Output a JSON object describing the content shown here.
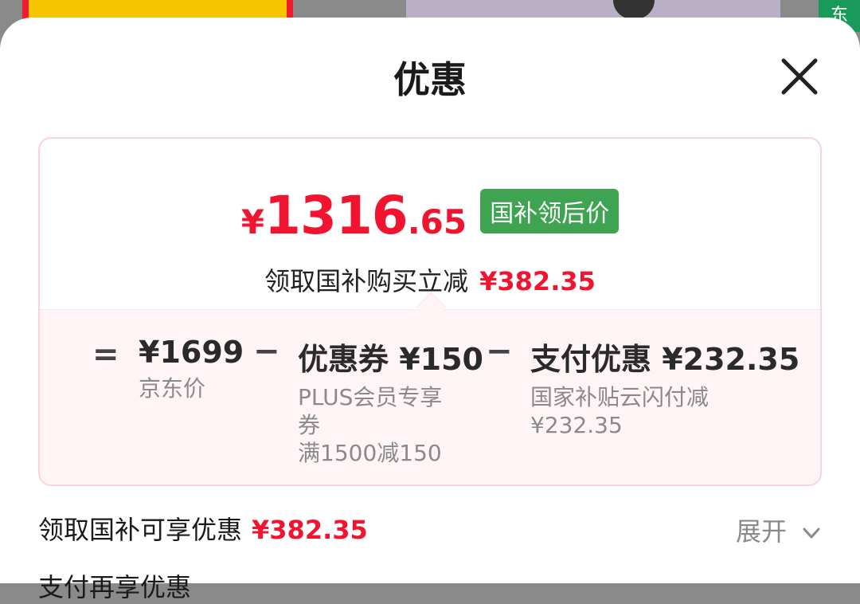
{
  "background": {
    "tag_text": "东",
    "promo_color": "#ee1c2c",
    "green_tag_color": "#1a9a5a"
  },
  "sheet": {
    "title": "优惠",
    "close_icon": "close-icon"
  },
  "price": {
    "currency": "¥",
    "integer": "1316",
    "decimal": ".65",
    "badge": "国补领后价",
    "accent_color": "#f0142f",
    "badge_color": "#3fa451"
  },
  "savings": {
    "label": "领取国补购买立减",
    "amount": "¥382.35"
  },
  "breakdown": {
    "equals": "=",
    "minus": "−",
    "base": {
      "value": "¥1699",
      "label": "京东价"
    },
    "coupon": {
      "value": "优惠券 ¥150",
      "line1": "PLUS会员专享",
      "line2": "券",
      "line3": "满1500减150"
    },
    "payment": {
      "value": "支付优惠 ¥232.35",
      "line1": "国家补贴云闪付减",
      "line2": "¥232.35"
    }
  },
  "subsidy_row": {
    "label": "领取国补可享优惠",
    "amount": "¥382.35",
    "expand": "展开",
    "expand_icon": "chevron-down-icon"
  },
  "next_row": {
    "label": "支付再享优惠"
  }
}
